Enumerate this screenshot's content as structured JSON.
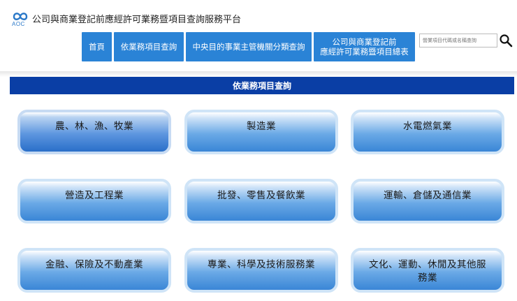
{
  "header": {
    "logo_text": "AOC",
    "site_title": "公司與商業登記前應經許可業務暨項目查詢服務平台"
  },
  "nav": {
    "items": [
      {
        "label": "首頁"
      },
      {
        "label": "依業務項目查詢"
      },
      {
        "label": "中央目的事業主管機關分類查詢"
      },
      {
        "label_line1": "公司與商業登記前",
        "label_line2": "應經許可業務暨項目總表"
      }
    ]
  },
  "search": {
    "placeholder": "營業項目代碼或名稱查詢"
  },
  "section": {
    "title": "依業務項目查詢"
  },
  "categories": [
    {
      "label": "農、林、漁、牧業"
    },
    {
      "label": "製造業"
    },
    {
      "label": "水電燃氣業"
    },
    {
      "label": "營造及工程業"
    },
    {
      "label": "批發、零售及餐飲業"
    },
    {
      "label": "運輸、倉儲及通信業"
    },
    {
      "label": "金融、保險及不動產業"
    },
    {
      "label": "專業、科學及技術服務業"
    },
    {
      "label": "文化、運動、休閒及其他服務業"
    }
  ],
  "colors": {
    "nav_bg": "#2a83d6",
    "section_bar": "#0a3ea5",
    "logo": "#2a78c8"
  }
}
